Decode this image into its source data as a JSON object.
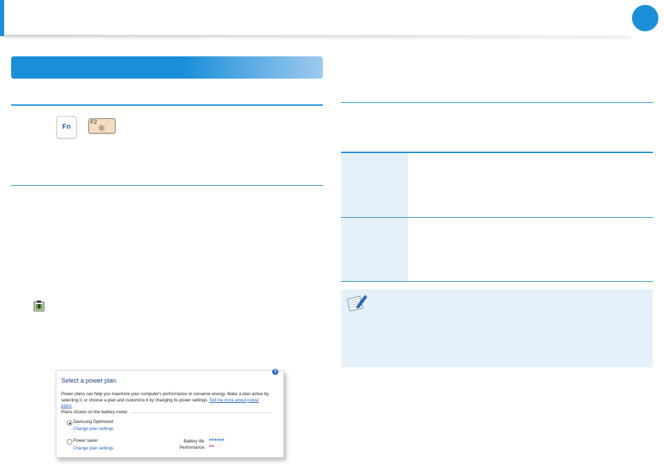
{
  "keys": {
    "fn_label": "Fn",
    "f2_label": "F2"
  },
  "icons": {
    "battery": "battery-plug-icon",
    "note": "note-pen-icon",
    "help": "help-icon",
    "sun": "brightness-sun-icon"
  },
  "colors": {
    "accent": "#1a8fd8",
    "shade": "#e5f0f9"
  },
  "power_dialog": {
    "help_glyph": "?",
    "title": "Select a power plan",
    "description": "Power plans can help you maximize your computer's performance or conserve energy. Make a plan active by selecting it, or choose a plan and customize it by changing its power settings.",
    "description_link": "Tell me more about power plans",
    "section_label": "Plans shown on the battery meter",
    "plans": [
      {
        "name": "Samsung Optimized",
        "selected": true,
        "change_link": "Change plan settings"
      },
      {
        "name": "Power saver",
        "selected": false,
        "change_link": "Change plan settings"
      }
    ],
    "battery_life_label": "Battery life:",
    "battery_life_dots": "●●●●●●",
    "performance_label": "Performance:",
    "performance_dots": "●●"
  }
}
